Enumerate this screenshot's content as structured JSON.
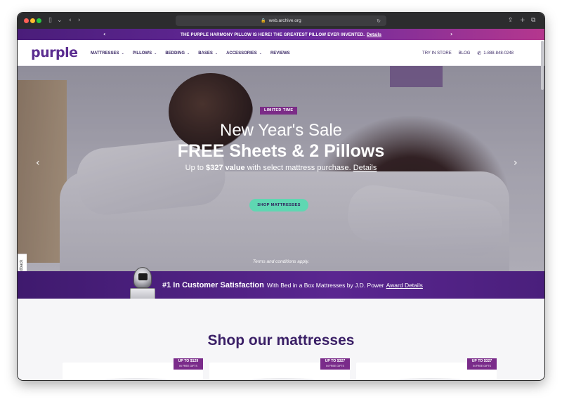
{
  "browser": {
    "url": "web.archive.org"
  },
  "promo": {
    "text": "THE PURPLE HARMONY PILLOW IS HERE! THE GREATEST PILLOW EVER INVENTED.",
    "link": "Details"
  },
  "nav": {
    "logo": "purple",
    "items": [
      {
        "label": "MATTRESSES"
      },
      {
        "label": "PILLOWS"
      },
      {
        "label": "BEDDING"
      },
      {
        "label": "BASES"
      },
      {
        "label": "ACCESSORIES"
      },
      {
        "label": "REVIEWS"
      }
    ],
    "try_in_store": "TRY IN STORE",
    "blog": "BLOG",
    "phone": "1-888-848-0248"
  },
  "hero": {
    "badge": "LIMITED TIME",
    "title1": "New Year's Sale",
    "title2": "FREE Sheets & 2 Pillows",
    "sub_prefix": "Up to ",
    "sub_value": "$327 value",
    "sub_suffix": " with select mattress purchase. ",
    "sub_link": "Details",
    "cta": "SHOP MATTRESSES",
    "terms": "Terms and conditions apply.",
    "slide_count": 2,
    "active_slide": 1
  },
  "feedback": "Feedback",
  "satisfaction": {
    "headline": "#1 In Customer Satisfaction",
    "text": "With Bed in a Box Mattresses by J.D. Power",
    "link": "Award Details"
  },
  "shop": {
    "title": "Shop our mattresses",
    "cards": [
      {
        "gift_amount": "UP TO $129",
        "gift_label": "IN FREE GIFTS"
      },
      {
        "gift_amount": "UP TO $327",
        "gift_label": "IN FREE GIFTS"
      },
      {
        "gift_amount": "UP TO $327",
        "gift_label": "IN FREE GIFTS"
      }
    ]
  },
  "colors": {
    "brand_purple": "#5b2d90",
    "cta_mint": "#5fd7b2",
    "badge_magenta": "#7b2c87"
  }
}
